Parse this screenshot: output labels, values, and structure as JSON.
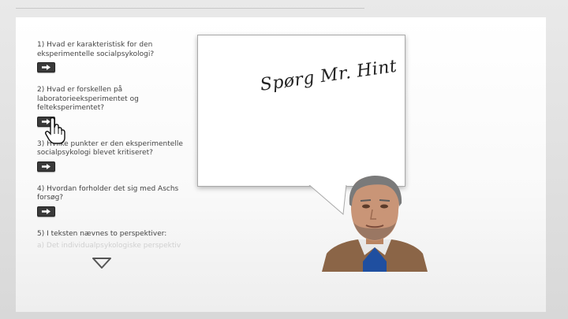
{
  "questions": [
    {
      "text": "1) Hvad er karakteristisk for den eksperimentelle socialpsykologi?"
    },
    {
      "text": "2) Hvad er forskellen på laboratorieeksperimentet og felteksperimentet?"
    },
    {
      "text": "3) Hvilke punkter er den eksperimentelle socialpsykologi blevet kritiseret?"
    },
    {
      "text": "4) Hvordan forholder det sig med Aschs forsøg?"
    },
    {
      "text": "5) I teksten nævnes to perspektiver:"
    },
    {
      "text": "a) Det individualpsykologiske perspektiv"
    }
  ],
  "speech_bubble": {
    "text": "Spørg Mr. Hint"
  },
  "icons": {
    "go_button": "arrow-right-icon",
    "scroll_down": "triangle-down-icon",
    "cursor": "hand-pointer-icon",
    "character": "mr-hint-avatar"
  },
  "colors": {
    "button_bg": "#3a3a3a",
    "text": "#444444",
    "panel_bg": "#ffffff"
  }
}
